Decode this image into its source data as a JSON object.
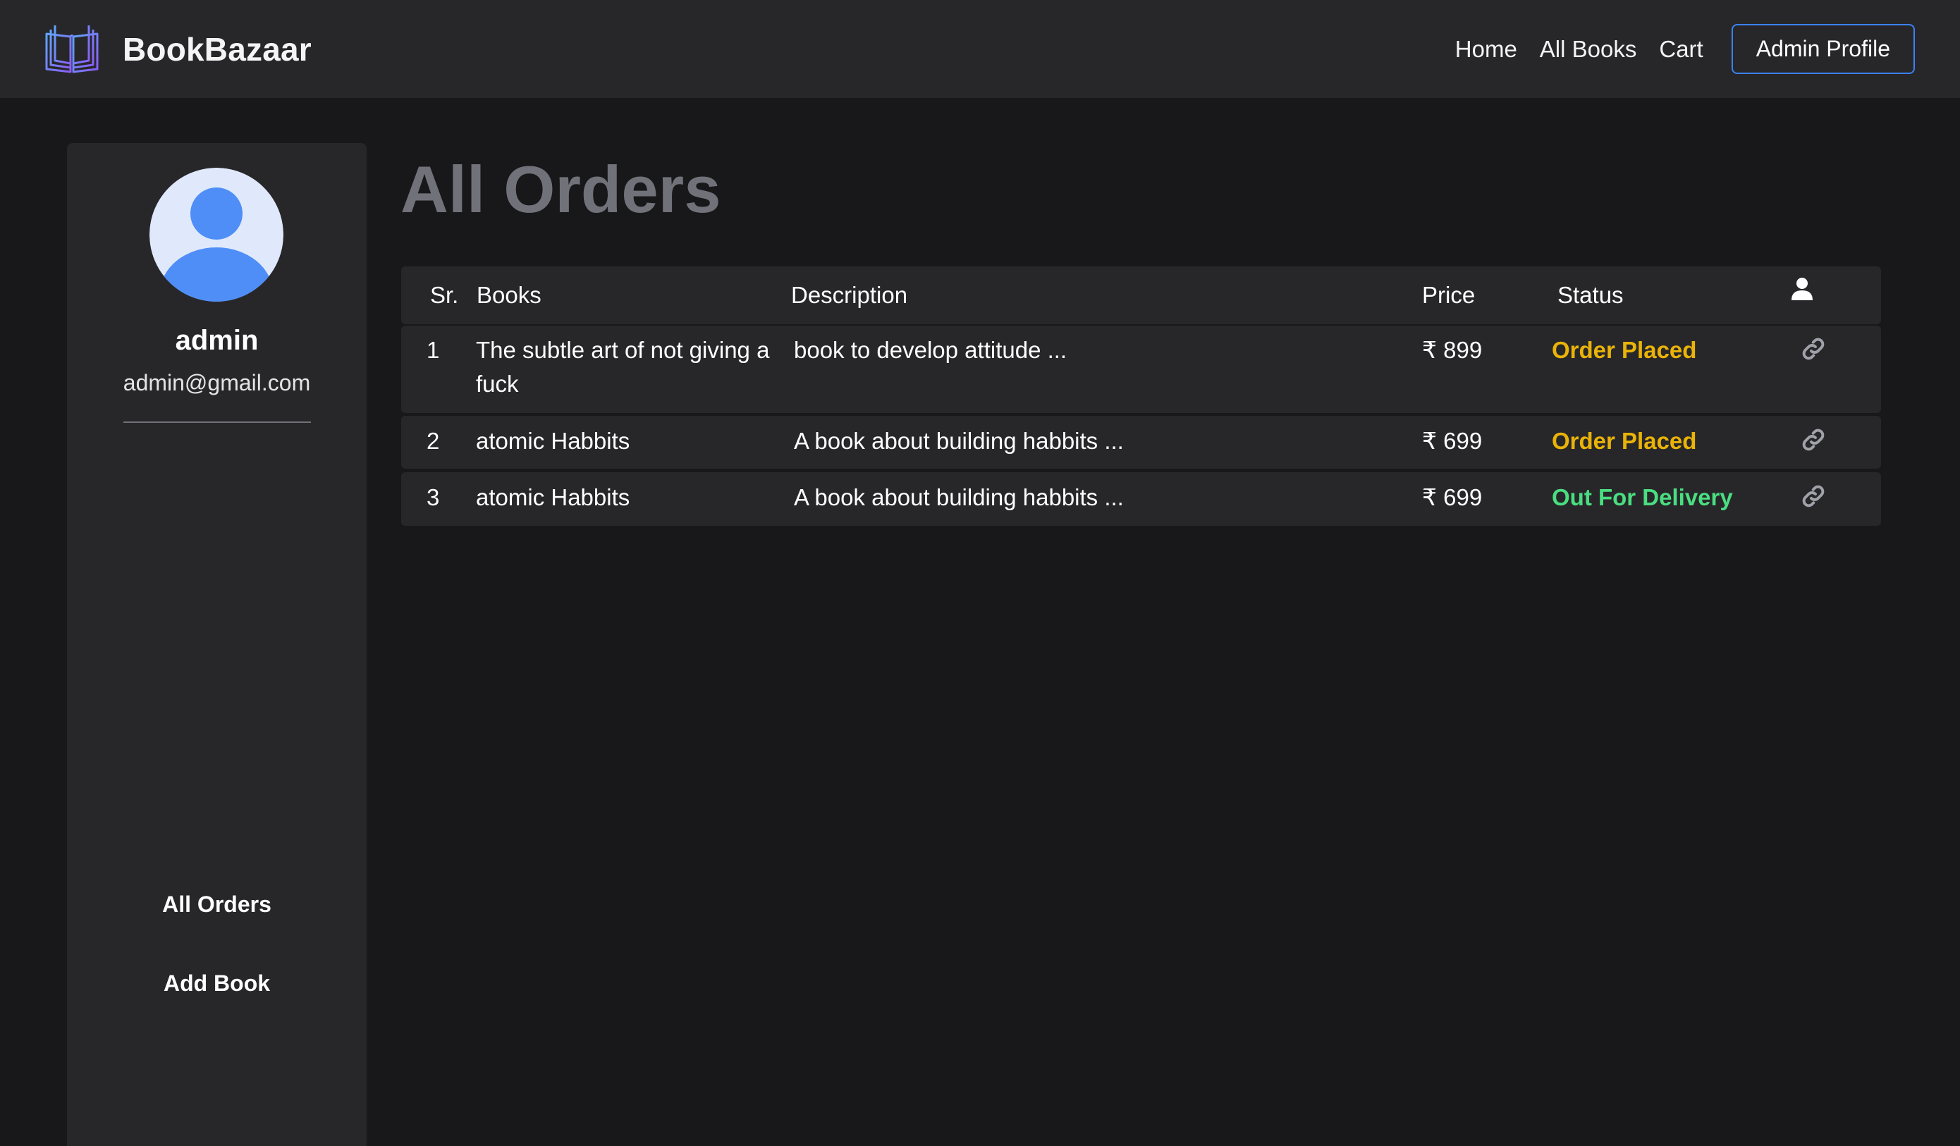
{
  "navbar": {
    "brand": "BookBazaar",
    "links": [
      "Home",
      "All Books",
      "Cart"
    ],
    "profile_button": "Admin Profile"
  },
  "sidebar": {
    "name": "admin",
    "email": "admin@gmail.com",
    "menu": [
      "All Orders",
      "Add Book"
    ]
  },
  "main": {
    "title": "All Orders",
    "columns": [
      "Sr.",
      "Books",
      "Description",
      "Price",
      "Status"
    ],
    "user_column_icon": "user-icon",
    "rows": [
      {
        "sr": "1",
        "book": "The subtle art of not giving a fuck",
        "description": "book to develop attitude ...",
        "price": "₹ 899",
        "status": "Order Placed",
        "status_color": "#eab308"
      },
      {
        "sr": "2",
        "book": "atomic Habbits",
        "description": "A book about building habbits ...",
        "price": "₹ 699",
        "status": "Order Placed",
        "status_color": "#eab308"
      },
      {
        "sr": "3",
        "book": "atomic Habbits",
        "description": "A book about building habbits ...",
        "price": "₹ 699",
        "status": "Out For Delivery",
        "status_color": "#4ade80"
      }
    ],
    "row_action_icon": "link-icon"
  },
  "colors": {
    "background": "#18181b",
    "panel": "#27272a",
    "accent": "#3b82f6",
    "title_gray": "#71717a"
  }
}
